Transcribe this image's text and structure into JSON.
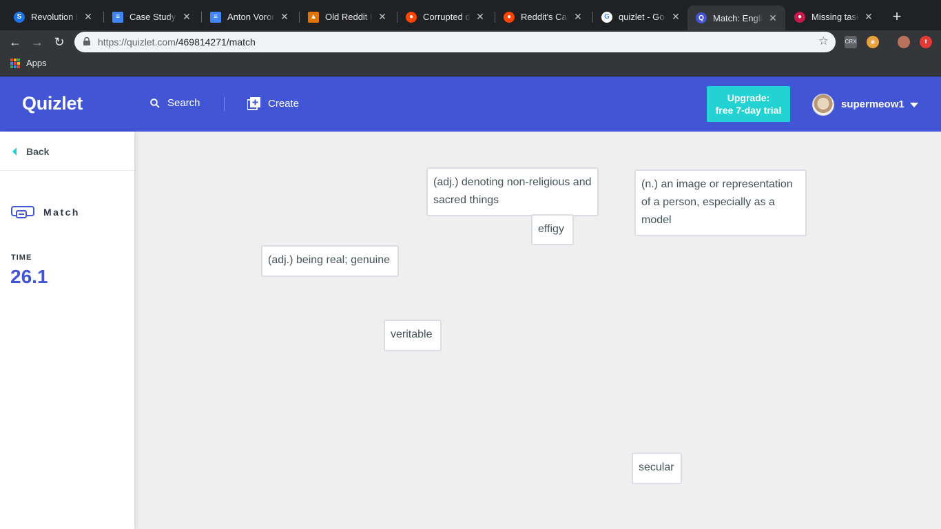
{
  "browser": {
    "tabs": [
      {
        "title": "Revolution in Tech",
        "favicon": "s-circle-icon",
        "color": "#1a73e8"
      },
      {
        "title": "Case Study: Mobile",
        "favicon": "docs-icon",
        "color": "#4285f4"
      },
      {
        "title": "Anton Voronov",
        "favicon": "docs-icon",
        "color": "#4285f4"
      },
      {
        "title": "Old Reddit Redirect",
        "favicon": "extension-icon",
        "color": "#e37400"
      },
      {
        "title": "Corrupted data",
        "favicon": "reddit-icon",
        "color": "#ff4500"
      },
      {
        "title": "Reddit's Campus",
        "favicon": "reddit-icon",
        "color": "#ff4500"
      },
      {
        "title": "quizlet - Google Search",
        "favicon": "google-icon",
        "color": "#ffffff"
      },
      {
        "title": "Match: English",
        "favicon": "quizlet-icon",
        "color": "#4255d4",
        "active": true
      },
      {
        "title": "Missing taskbar",
        "favicon": "raspberry-icon",
        "color": "#c51a4a"
      }
    ],
    "url_host": "https://quizlet.com",
    "url_path": "/469814271/match",
    "bookmarks": {
      "apps_label": "Apps"
    }
  },
  "header": {
    "logo": "Quizlet",
    "search_label": "Search",
    "create_label": "Create",
    "upgrade_line1": "Upgrade:",
    "upgrade_line2": "free 7-day trial",
    "username": "supermeow1..."
  },
  "sidebar": {
    "back_label": "Back",
    "mode_label": "Match",
    "time_label": "TIME",
    "time_value": "26.1"
  },
  "tiles": [
    {
      "text": "(adj.) denoting non-religious and sacred things"
    },
    {
      "text": "(n.) an image or representation of a person, especially as a model"
    },
    {
      "text": "effigy"
    },
    {
      "text": "(adj.) being real; genuine"
    },
    {
      "text": "veritable"
    },
    {
      "text": "secular"
    }
  ],
  "colors": {
    "brand": "#4255d4",
    "accent": "#23d3d3",
    "page_bg": "#efefef"
  }
}
